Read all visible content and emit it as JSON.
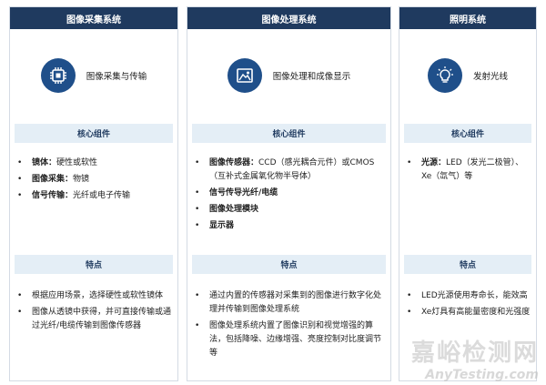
{
  "columns": [
    {
      "title": "图像采集系统",
      "icon": "chip-icon",
      "topic": "图像采集与传输",
      "components_header": "核心组件",
      "components": [
        {
          "bold": "镜体：",
          "text": "硬性或软性"
        },
        {
          "bold": "图像采集：",
          "text": "物镜"
        },
        {
          "bold": "信号传输：",
          "text": "光纤或电子传输"
        }
      ],
      "features_header": "特点",
      "features": [
        "根据应用场景，选择硬性或软性镜体",
        "图像从透镜中获得，并可直接传输或通过光纤/电缆传输到图像传感器"
      ]
    },
    {
      "title": "图像处理系统",
      "icon": "image-icon",
      "topic": "图像处理和成像显示",
      "components_header": "核心组件",
      "components": [
        {
          "bold": "图像传感器：",
          "text": "CCD（感光耦合元件）或CMOS（互补式金属氧化物半导体）"
        },
        {
          "bold": "信号传导光纤/电缆",
          "text": ""
        },
        {
          "bold": "图像处理模块",
          "text": ""
        },
        {
          "bold": "显示器",
          "text": ""
        }
      ],
      "features_header": "特点",
      "features": [
        "通过内置的传感器对采集到的图像进行数字化处理并传输到图像处理系统",
        "图像处理系统内置了图像识别和视觉增强的算法，包括降噪、边缘增强、亮度控制对比度调节等"
      ]
    },
    {
      "title": "照明系统",
      "icon": "lightbulb-icon",
      "topic": "发射光线",
      "components_header": "核心组件",
      "components": [
        {
          "bold": "光源：",
          "text": "LED（发光二极管）、Xe（氙气）等"
        }
      ],
      "features_header": "特点",
      "features": [
        "LED光源使用寿命长，能效高",
        "Xe灯具有高能量密度和光强度"
      ]
    }
  ],
  "watermark": {
    "cn": "嘉峪检测网",
    "en": "AnyTesting.com"
  },
  "colors": {
    "header": "#1f3a5f",
    "band": "#e4eef6",
    "icon": "#1f4f8a"
  }
}
